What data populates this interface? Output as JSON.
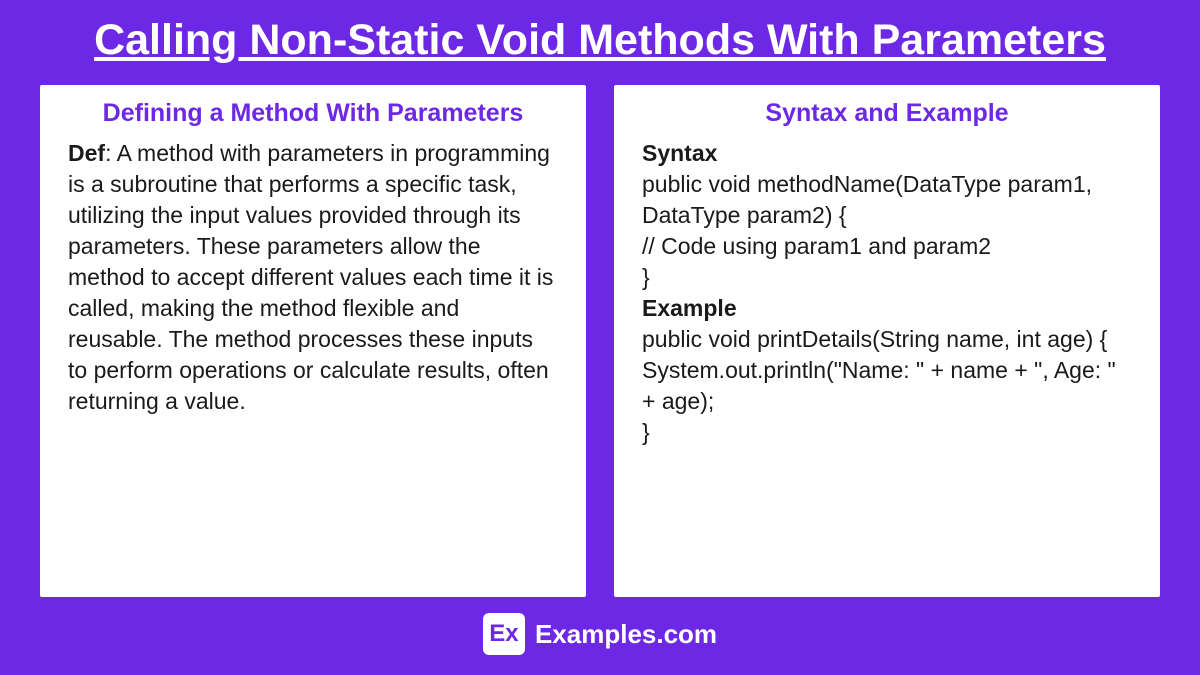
{
  "title": "Calling Non-Static Void Methods With Parameters",
  "leftPanel": {
    "heading": "Defining a Method With Parameters",
    "defLabel": "Def",
    "defText": ": A method with parameters in programming is a subroutine that performs a specific task, utilizing the input values provided through its parameters. These parameters allow the method to accept different values each time it is called, making the method flexible and reusable. The method processes these inputs to perform operations or calculate results, often returning a value."
  },
  "rightPanel": {
    "heading": "Syntax and Example",
    "syntaxLabel": "Syntax",
    "syntaxLine1": "public void methodName(DataType param1, DataType param2) {",
    "syntaxLine2": " // Code using param1 and param2",
    "syntaxLine3": "}",
    "exampleLabel": "Example",
    "exampleLine1": "public void printDetails(String name, int age) {",
    "exampleLine2": "System.out.println(\"Name: \" + name + \", Age: \" + age);",
    "exampleLine3": "}"
  },
  "footer": {
    "iconText": "Ex",
    "siteName": "Examples.com"
  }
}
